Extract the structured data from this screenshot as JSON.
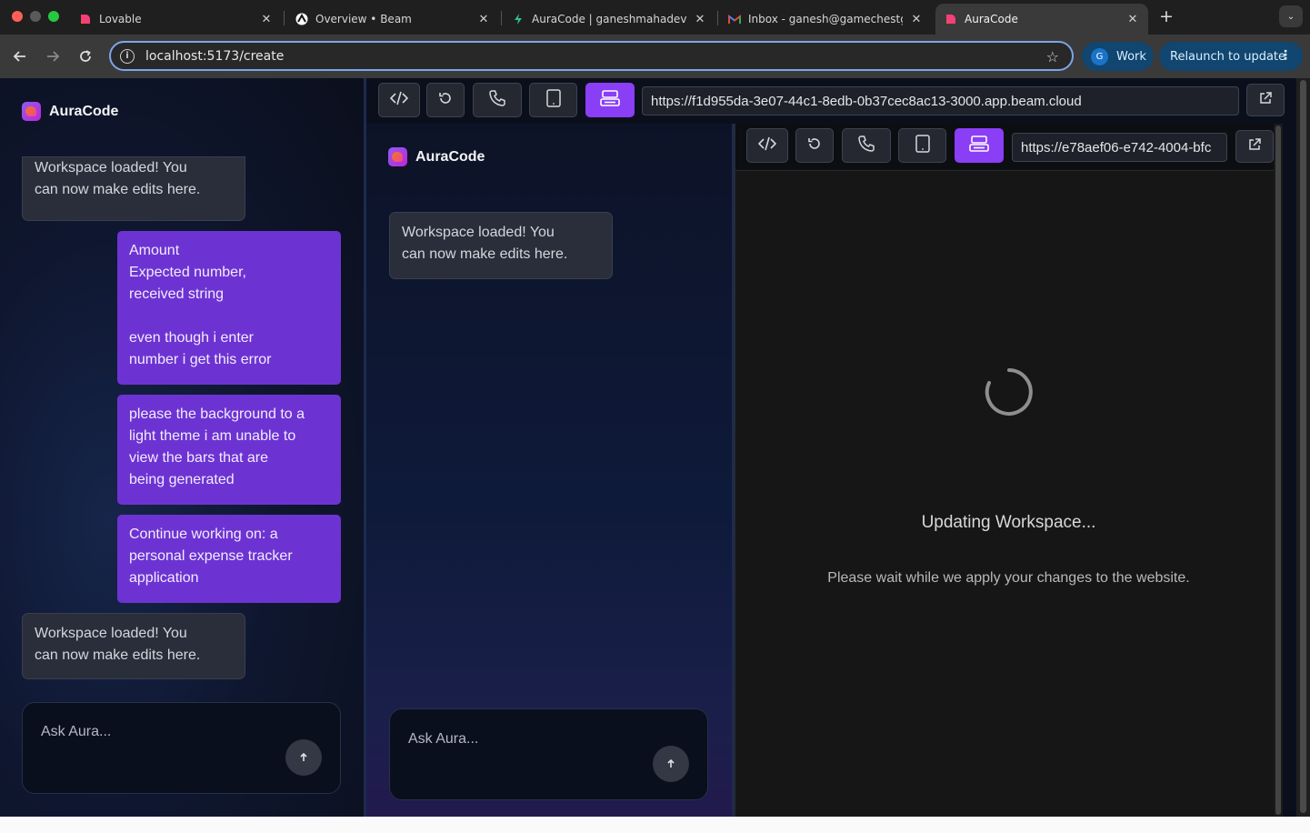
{
  "browser": {
    "tabs": [
      {
        "title": "Lovable",
        "icon": "lovable-heart-icon",
        "active": false
      },
      {
        "title": "Overview • Beam",
        "icon": "beam-icon",
        "active": false
      },
      {
        "title": "AuraCode | ganeshmahadev |",
        "icon": "bolt-icon",
        "active": false
      },
      {
        "title": "Inbox - ganesh@gamechestg",
        "icon": "gmail-icon",
        "active": false
      },
      {
        "title": "AuraCode",
        "icon": "lovable-heart-icon",
        "active": true
      }
    ],
    "url": "localhost:5173/create",
    "profile_initial": "G",
    "profile_label": "Work",
    "relaunch_label": "Relaunch to update"
  },
  "app": {
    "brand": "AuraCode",
    "chat": [
      {
        "role": "assistant",
        "text": "Workspace loaded! You\ncan now make edits here."
      },
      {
        "role": "user",
        "text": "Amount\nExpected number,\nreceived string\n\neven though i enter\nnumber i get this error"
      },
      {
        "role": "user",
        "text": "please the background to a\nlight theme i am unable to\nview the bars that are\nbeing generated"
      },
      {
        "role": "user",
        "text": "Continue working on: a\npersonal expense tracker\napplication"
      },
      {
        "role": "assistant",
        "text": "Workspace loaded! You\ncan now make edits here."
      }
    ],
    "input_placeholder": "Ask Aura..."
  },
  "preview": {
    "url": "https://f1d955da-3e07-44c1-8edb-0b37cec8ac13-3000.app.beam.cloud",
    "toolbar_icons": [
      "code-icon",
      "refresh-icon",
      "phone-icon",
      "tablet-icon",
      "desktop-icon"
    ],
    "active_view": "desktop",
    "inner": {
      "brand": "AuraCode",
      "chat": [
        {
          "role": "assistant",
          "text": "Workspace loaded! You\ncan now make edits here."
        }
      ],
      "input_placeholder": "Ask Aura...",
      "nested_url": "https://e78aef06-e742-4004-bfc",
      "status_title": "Updating Workspace...",
      "status_message": "Please wait while we apply your changes to the website."
    }
  },
  "colors": {
    "accent": "#8a3ef6",
    "user_bubble": "#6d33d2",
    "assistant_bubble": "#2a2e3a",
    "chrome_profile": "#10466f"
  }
}
